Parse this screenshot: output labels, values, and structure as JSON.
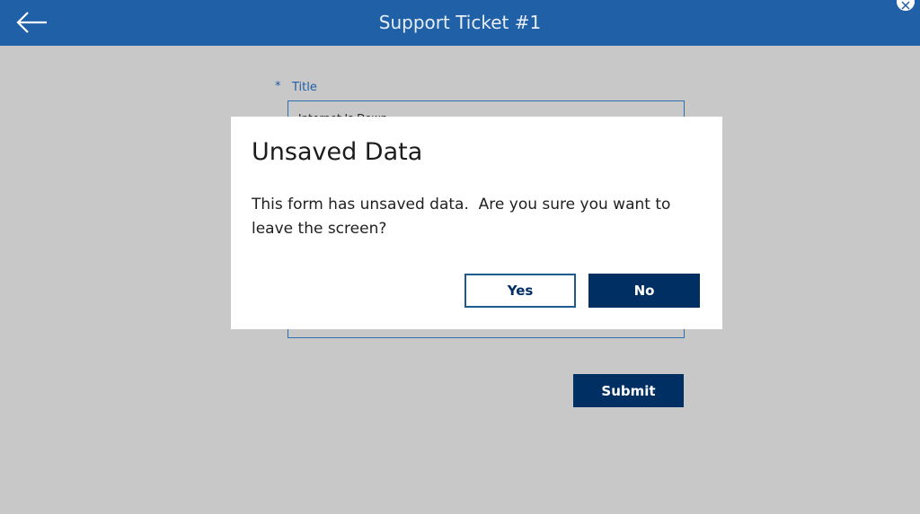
{
  "header": {
    "title": "Support Ticket #1",
    "back_icon": "arrow-left-icon",
    "close_icon": "close-icon",
    "color": "#2060a6"
  },
  "form": {
    "required_marker": "*",
    "title_label": "Title",
    "title_value": "Internet Is Down",
    "submit_label": "Submit"
  },
  "dialog": {
    "title": "Unsaved Data",
    "message": "This form has unsaved data.  Are you sure you want to leave the screen?",
    "yes_label": "Yes",
    "no_label": "No"
  },
  "colors": {
    "overlay_background": "#c8c8c8",
    "primary_button": "#002f64",
    "dialog_background": "#ffffff"
  }
}
